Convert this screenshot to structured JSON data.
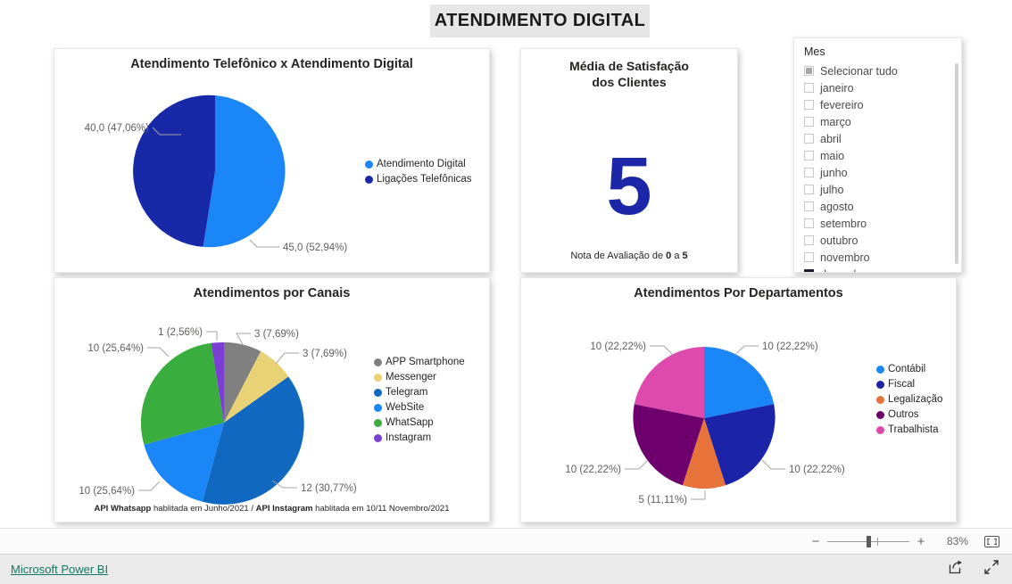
{
  "report": {
    "title": "ATENDIMENTO DIGITAL"
  },
  "colors": {
    "digital_blue": "#1a86f7",
    "phone_navy": "#1829a8",
    "card_navy": "#1b26a8",
    "app_gray": "#808080",
    "messenger_yellow": "#e8d275",
    "telegram_blue": "#1168c0",
    "website_blue": "#1a86f7",
    "whatsapp_green": "#39ae3f",
    "instagram_purple": "#7b3fd4",
    "contabil_blue": "#1a86f7",
    "fiscal_navy": "#1b24a8",
    "legalizacao_orange": "#e8733a",
    "outros_purple": "#6d006d",
    "trabalhista_pink": "#dd49ac",
    "title_band": "#e6e6e6",
    "footer_link": "#117865"
  },
  "chart_data": [
    {
      "type": "pie",
      "name": "atendimento-telefonico-x-digital",
      "title": "Atendimento Telefônico x Atendimento Digital",
      "categories": [
        "Atendimento Digital",
        "Ligações Telefônicas"
      ],
      "values": [
        45.0,
        40.0
      ],
      "percents": [
        52.94,
        47.06
      ],
      "data_labels": [
        "45,0 (52,94%)",
        "40,0 (47,06%)"
      ],
      "colors": [
        "#1a86f7",
        "#1829a8"
      ],
      "legend_position": "right",
      "legend": [
        {
          "label": "Atendimento Digital",
          "color": "#1a86f7"
        },
        {
          "label": "Ligações Telefônicas",
          "color": "#1829a8"
        }
      ]
    },
    {
      "type": "pie",
      "name": "atendimentos-por-canais",
      "title": "Atendimentos por Canais",
      "categories": [
        "APP Smartphone",
        "Messenger",
        "Telegram",
        "WebSite",
        "WhatSapp",
        "Instagram"
      ],
      "values": [
        3,
        3,
        12,
        10,
        10,
        1
      ],
      "percents": [
        7.69,
        7.69,
        30.77,
        25.64,
        25.64,
        2.56
      ],
      "data_labels": [
        "3 (7,69%)",
        "3 (7,69%)",
        "12 (30,77%)",
        "10 (25,64%)",
        "10 (25,64%)",
        "1 (2,56%)"
      ],
      "colors": [
        "#808080",
        "#e8d275",
        "#1168c0",
        "#1a86f7",
        "#39ae3f",
        "#7b3fd4"
      ],
      "legend_position": "right",
      "legend": [
        {
          "label": "APP Smartphone",
          "color": "#808080"
        },
        {
          "label": "Messenger",
          "color": "#e8d275"
        },
        {
          "label": "Telegram",
          "color": "#1168c0"
        },
        {
          "label": "WebSite",
          "color": "#1a86f7"
        },
        {
          "label": "WhatSapp",
          "color": "#39ae3f"
        },
        {
          "label": "Instagram",
          "color": "#7b3fd4"
        }
      ],
      "footnote_bold_1": "API Whatsapp",
      "footnote_mid": " hablitada em Junho/2021 / ",
      "footnote_bold_2": "API Instagram",
      "footnote_end": " hablitada em 10/11 Novembro/2021"
    },
    {
      "type": "pie",
      "name": "atendimentos-por-departamentos",
      "title": "Atendimentos Por Departamentos",
      "categories": [
        "Contábil",
        "Fiscal",
        "Legalização",
        "Outros",
        "Trabalhista"
      ],
      "values": [
        10,
        10,
        5,
        10,
        10
      ],
      "percents": [
        22.22,
        22.22,
        11.11,
        22.22,
        22.22
      ],
      "data_labels": [
        "10 (22,22%)",
        "10 (22,22%)",
        "5 (11,11%)",
        "10 (22,22%)",
        "10 (22,22%)"
      ],
      "colors": [
        "#1a86f7",
        "#1b24a8",
        "#e8733a",
        "#6d006d",
        "#dd49ac"
      ],
      "legend_position": "right",
      "legend": [
        {
          "label": "Contábil",
          "color": "#1a86f7"
        },
        {
          "label": "Fiscal",
          "color": "#1b24a8"
        },
        {
          "label": "Legalização",
          "color": "#e8733a"
        },
        {
          "label": "Outros",
          "color": "#6d006d"
        },
        {
          "label": "Trabalhista",
          "color": "#dd49ac"
        }
      ]
    }
  ],
  "satisfaction_card": {
    "heading_line1": "Média de Satisfação",
    "heading_line2": "dos Clientes",
    "value": "5",
    "footer_prefix": "Nota de Avaliação de ",
    "footer_min": "0",
    "footer_mid": " a ",
    "footer_max": "5"
  },
  "slicer": {
    "header": "Mes",
    "select_all": "Selecionar tudo",
    "items": [
      {
        "label": "janeiro",
        "checked": false
      },
      {
        "label": "fevereiro",
        "checked": false
      },
      {
        "label": "março",
        "checked": false
      },
      {
        "label": "abril",
        "checked": false
      },
      {
        "label": "maio",
        "checked": false
      },
      {
        "label": "junho",
        "checked": false
      },
      {
        "label": "julho",
        "checked": false
      },
      {
        "label": "agosto",
        "checked": false
      },
      {
        "label": "setembro",
        "checked": false
      },
      {
        "label": "outubro",
        "checked": false
      },
      {
        "label": "novembro",
        "checked": false
      },
      {
        "label": "dezembro",
        "checked": true
      }
    ]
  },
  "zoom_bar": {
    "minus": "−",
    "plus": "+",
    "percent": "83%"
  },
  "footer": {
    "link": "Microsoft Power BI"
  }
}
